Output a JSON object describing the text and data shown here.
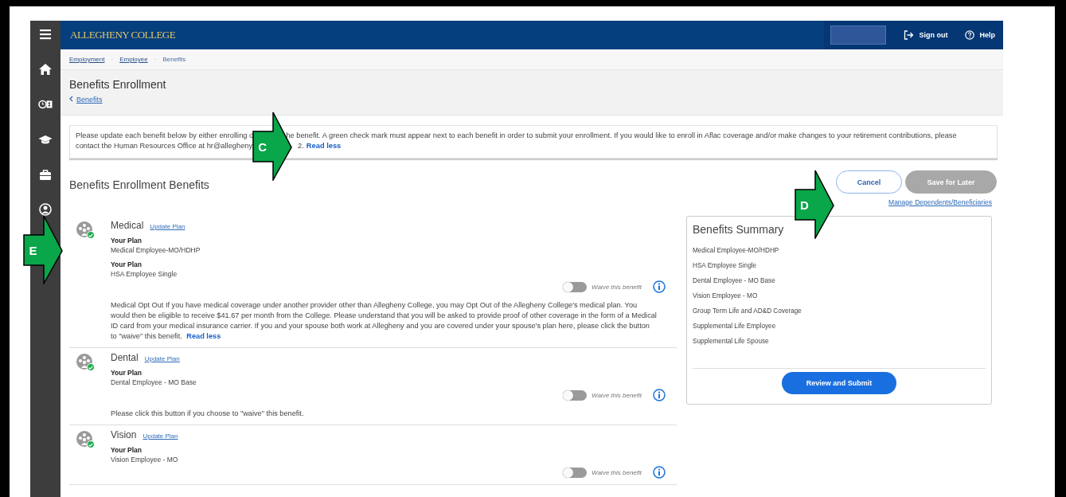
{
  "header": {
    "logo": "ALLEGHENY COLLEGE",
    "sign_out": "Sign out",
    "help": "Help"
  },
  "breadcrumbs": [
    {
      "label": "Employment",
      "link": true
    },
    {
      "label": "Employee",
      "link": true
    },
    {
      "label": "Benefits",
      "link": false
    }
  ],
  "breadcrumb_separator": "·",
  "page_title": "Benefits Enrollment",
  "back_link": "Benefits",
  "notice": {
    "lines": [
      [
        "Please update each benefit below by either enrolling o",
        "he benefit. A green check mark must appear next to each benefit in order to submit your enrollment. If you would like to enroll in Aflac coverage and/or make changes to your retirement contributions, please"
      ],
      [
        "contact the Human Resources Office at hr@allegheny.",
        "2."
      ]
    ],
    "link": "Read less"
  },
  "section_title": "Benefits Enrollment Benefits",
  "buttons": [
    {
      "label": "Cancel",
      "kind": "outline",
      "disabled": false
    },
    {
      "label": "Save for Later",
      "kind": "solid",
      "disabled": true
    }
  ],
  "manage_link": "Manage Dependents/Beneficiaries",
  "benefits": [
    {
      "name": "Medical",
      "update_link": "Update Plan",
      "completed": true,
      "plans": [
        {
          "label": "Your Plan",
          "value": "Medical Employee-MO/HDHP"
        },
        {
          "label": "Your Plan",
          "value": "HSA Employee Single"
        }
      ],
      "waive": {
        "label": "Waive this benefit",
        "on": false
      },
      "description": "Medical Opt Out If you have medical coverage under another provider other than Allegheny College, you may Opt Out of the Allegheny College's medical plan. You would then be eligible to receive $41.67 per month from the College. Please understand that you will be asked to provide proof of other coverage in the form of a Medical ID card from your medical insurance carrier. If you and your spouse both work at Allegheny and you are covered under your spouse's plan here, please click the button to \"waive\" this benefit.",
      "description_link": "Read less"
    },
    {
      "name": "Dental",
      "update_link": "Update Plan",
      "completed": true,
      "plans": [
        {
          "label": "Your Plan",
          "value": "Dental Employee - MO Base"
        }
      ],
      "waive": {
        "label": "Waive this benefit",
        "on": false
      },
      "description": "Please click this button if you choose to \"waive\" this benefit."
    },
    {
      "name": "Vision",
      "update_link": "Update Plan",
      "completed": true,
      "plans": [
        {
          "label": "Your Plan",
          "value": "Vision Employee - MO"
        }
      ],
      "waive": {
        "label": "Waive this benefit",
        "on": false
      }
    }
  ],
  "summary": {
    "title": "Benefits Summary",
    "items": [
      "Medical Employee-MO/HDHP",
      "HSA Employee Single",
      "Dental Employee - MO Base",
      "Vision Employee - MO",
      "Group Term Life and AD&D Coverage",
      "Supplemental Life Employee",
      "Supplemental Life Spouse"
    ],
    "button": "Review and Submit"
  },
  "callouts": [
    {
      "letter": "C"
    },
    {
      "letter": "D"
    },
    {
      "letter": "E"
    }
  ]
}
